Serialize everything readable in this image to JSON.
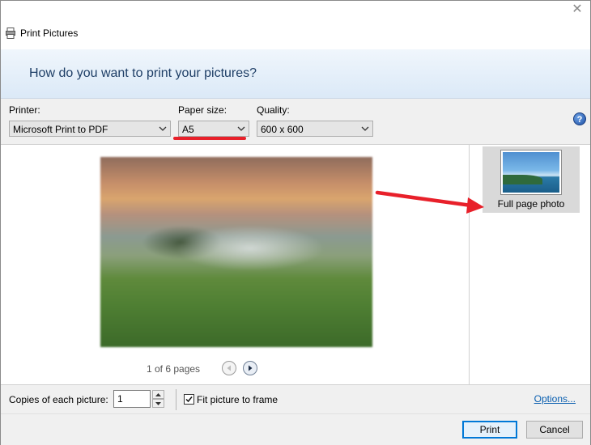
{
  "window": {
    "title": "Print Pictures",
    "icons": {
      "app": "printer-icon",
      "close": "close-icon"
    }
  },
  "banner": {
    "heading": "How do you want to print your pictures?"
  },
  "options": {
    "printer_label": "Printer:",
    "printer_value": "Microsoft Print to PDF",
    "paper_size_label": "Paper size:",
    "paper_size_value": "A5",
    "quality_label": "Quality:",
    "quality_value": "600 x 600",
    "help": "?"
  },
  "preview": {
    "page_status": "1 of 6 pages",
    "icons": {
      "prev": "chevron-left-icon",
      "next": "chevron-right-icon"
    }
  },
  "layouts": {
    "items": [
      {
        "label": "Full page photo",
        "selected": true
      }
    ]
  },
  "bottom": {
    "copies_label": "Copies of each picture:",
    "copies_value": "1",
    "fit_label": "Fit picture to frame",
    "fit_checked": true,
    "options_link": "Options..."
  },
  "footer": {
    "print_label": "Print",
    "cancel_label": "Cancel"
  },
  "annotations": {
    "highlight_color": "#e8202a"
  }
}
